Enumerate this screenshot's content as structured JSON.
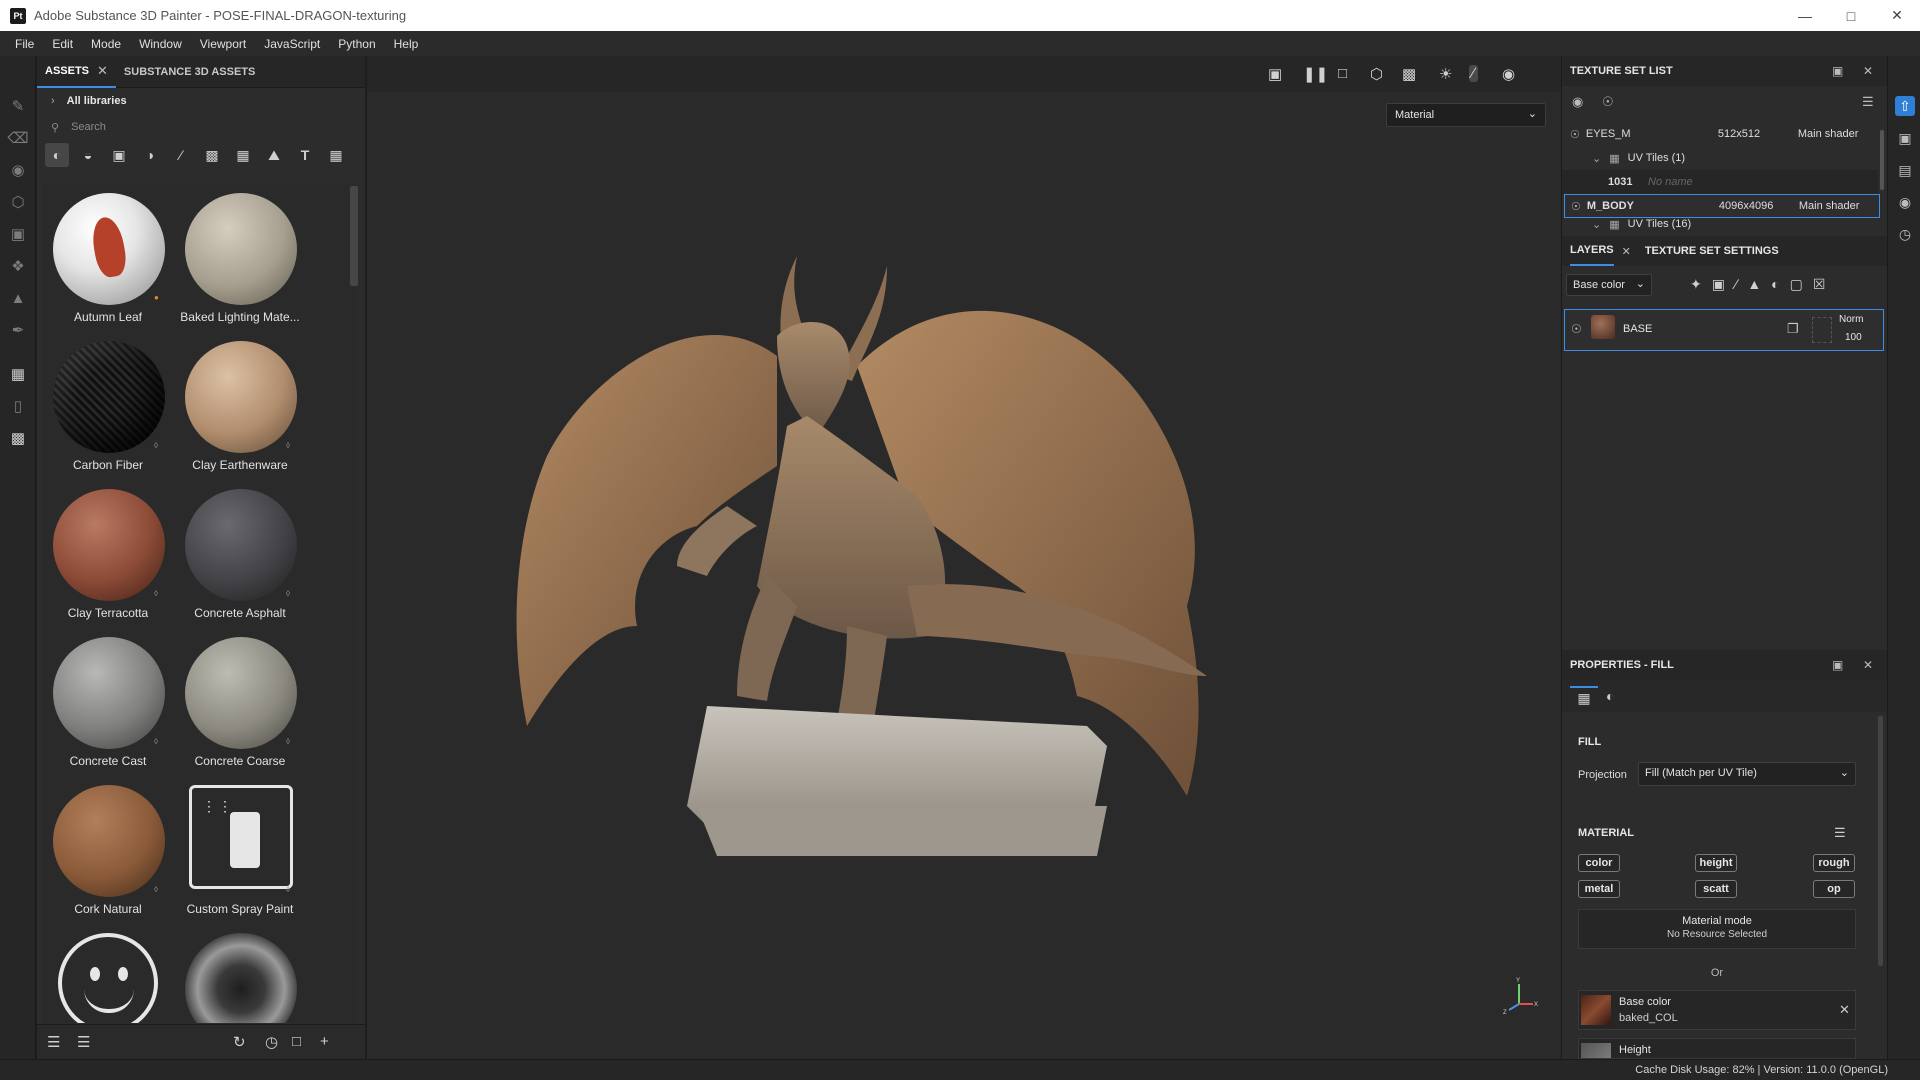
{
  "window": {
    "title": "Adobe Substance 3D Painter - POSE-FINAL-DRAGON-texturing",
    "app_badge": "Pt"
  },
  "menu": [
    "File",
    "Edit",
    "Mode",
    "Window",
    "Viewport",
    "JavaScript",
    "Python",
    "Help"
  ],
  "assets": {
    "tabs": [
      {
        "label": "ASSETS",
        "active": true
      },
      {
        "label": "SUBSTANCE 3D ASSETS",
        "active": false
      }
    ],
    "library": "All libraries",
    "search_placeholder": "Search",
    "items": [
      {
        "label": "Autumn Leaf"
      },
      {
        "label": "Baked Lighting Mate..."
      },
      {
        "label": "Carbon Fiber"
      },
      {
        "label": "Clay Earthenware"
      },
      {
        "label": "Clay Terracotta"
      },
      {
        "label": "Concrete Asphalt"
      },
      {
        "label": "Concrete Cast"
      },
      {
        "label": "Concrete Coarse"
      },
      {
        "label": "Cork Natural"
      },
      {
        "label": "Custom Spray Paint"
      },
      {
        "label": ""
      },
      {
        "label": ""
      }
    ]
  },
  "viewport": {
    "mode_select": "Material",
    "axis_labels": {
      "y": "Y",
      "x": "X",
      "z": "Z"
    }
  },
  "texture_set_list": {
    "title": "TEXTURE SET LIST",
    "sets": [
      {
        "name": "EYES_M",
        "resolution": "512x512",
        "shader": "Main shader"
      },
      {
        "name": "M_BODY",
        "resolution": "4096x4096",
        "shader": "Main shader",
        "selected": true
      }
    ],
    "uv_tiles_eyes": "UV Tiles (1)",
    "tile_id": "1031",
    "tile_name": "No name",
    "uv_tiles_body": "UV Tiles (16)"
  },
  "layers": {
    "tabs": [
      "LAYERS",
      "TEXTURE SET SETTINGS"
    ],
    "channel": "Base color",
    "items": [
      {
        "name": "BASE",
        "blend": "Norm",
        "opacity": "100"
      }
    ]
  },
  "properties": {
    "title": "PROPERTIES - FILL",
    "fill_header": "FILL",
    "projection_label": "Projection",
    "projection_value": "Fill (Match per UV Tile)",
    "material_header": "MATERIAL",
    "channels": [
      "color",
      "height",
      "rough",
      "metal",
      "scatt",
      "op"
    ],
    "material_mode_label": "Material mode",
    "material_mode_value": "No Resource Selected",
    "or": "Or",
    "slots": [
      {
        "name": "Base color",
        "resource": "baked_COL"
      },
      {
        "name": "Height",
        "resource": ""
      }
    ]
  },
  "status": {
    "text": "Cache Disk Usage:   82% | Version: 11.0.0 (OpenGL)"
  }
}
